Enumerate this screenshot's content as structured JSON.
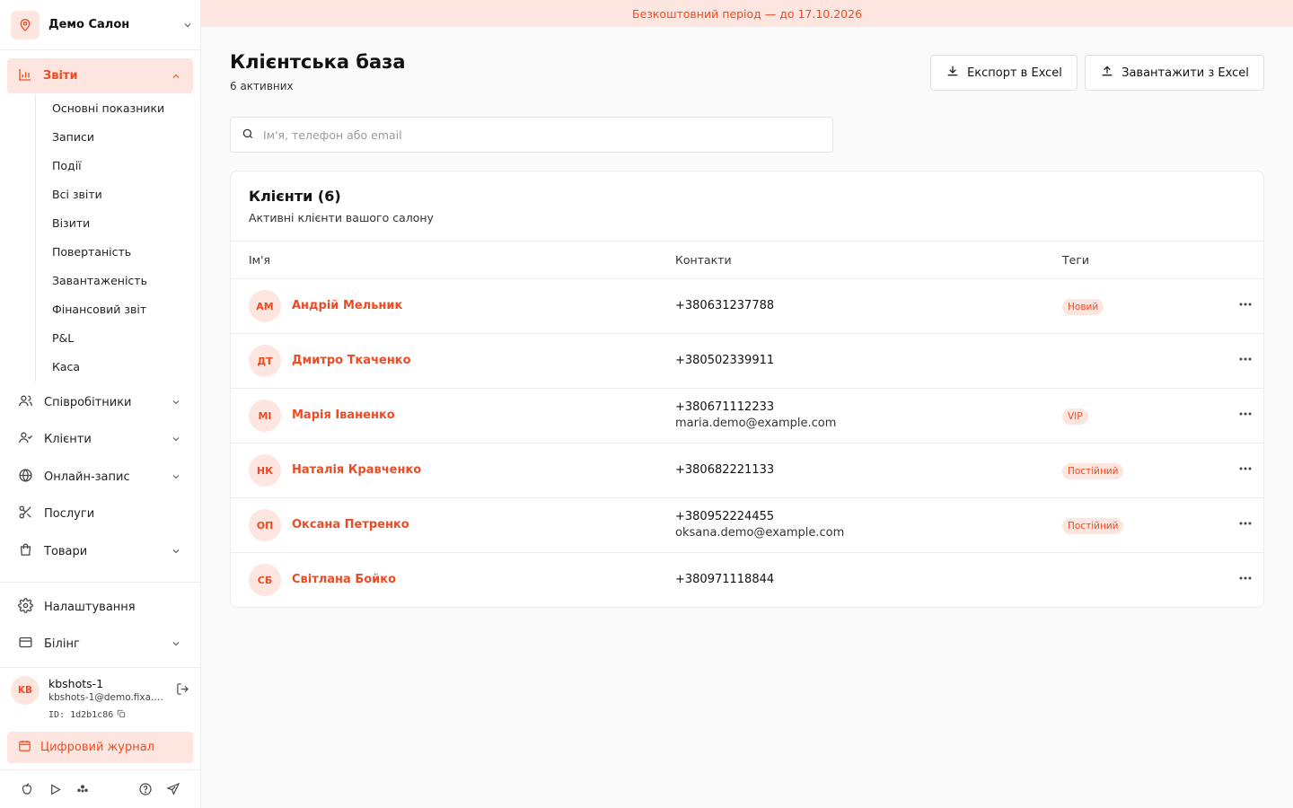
{
  "salon": {
    "name": "Демо Салон",
    "icon": "map-pin-icon"
  },
  "sidebar": {
    "reports": {
      "label": "Звіти",
      "icon": "bar-chart-icon"
    },
    "report_items": [
      "Основні показники",
      "Записи",
      "Події",
      "Всі звіти",
      "Візити",
      "Повертаність",
      "Завантаженість",
      "Фінансовий звіт",
      "P&L",
      "Каса"
    ],
    "items": [
      {
        "label": "Співробітники",
        "icon": "users-icon"
      },
      {
        "label": "Клієнти",
        "icon": "user-check-icon"
      },
      {
        "label": "Онлайн-запис",
        "icon": "globe-icon"
      },
      {
        "label": "Послуги",
        "icon": "scissors-icon"
      },
      {
        "label": "Товари",
        "icon": "shopping-bag-icon"
      }
    ],
    "settings": {
      "label": "Налаштування",
      "icon": "gear-icon"
    },
    "billing": {
      "label": "Білінг",
      "icon": "credit-card-icon"
    },
    "journal": {
      "label": "Цифровий журнал",
      "icon": "calendar-icon"
    }
  },
  "user": {
    "initials": "KB",
    "name": "kbshots-1",
    "email": "kbshots-1@demo.fixa.b...",
    "id": "ID: 1d2b1c86"
  },
  "banner": "Безкоштовний період — до 17.10.2026",
  "page": {
    "title": "Клієнтська база",
    "subtitle": "6 активних",
    "export_label": "Експорт в Excel",
    "import_label": "Завантажити з Excel"
  },
  "search": {
    "placeholder": "Ім'я, телефон або email"
  },
  "card": {
    "title": "Клієнти (6)",
    "subtitle": "Активні клієнти вашого салону",
    "columns": [
      "Ім'я",
      "Контакти",
      "Теги"
    ]
  },
  "clients": [
    {
      "initials": "АМ",
      "name": "Андрій Мельник",
      "phone": "+380631237788",
      "email": "",
      "tag": "Новий"
    },
    {
      "initials": "ДТ",
      "name": "Дмитро Ткаченко",
      "phone": "+380502339911",
      "email": "",
      "tag": ""
    },
    {
      "initials": "МІ",
      "name": "Марія Іваненко",
      "phone": "+380671112233",
      "email": "maria.demo@example.com",
      "tag": "VIP"
    },
    {
      "initials": "НК",
      "name": "Наталія Кравченко",
      "phone": "+380682221133",
      "email": "",
      "tag": "Постійний"
    },
    {
      "initials": "ОП",
      "name": "Оксана Петренко",
      "phone": "+380952224455",
      "email": "oksana.demo@example.com",
      "tag": "Постійний"
    },
    {
      "initials": "СБ",
      "name": "Світлана Бойко",
      "phone": "+380971118844",
      "email": "",
      "tag": ""
    }
  ],
  "colors": {
    "accent": "#ec4c25",
    "accent_bg": "#fde6df"
  }
}
